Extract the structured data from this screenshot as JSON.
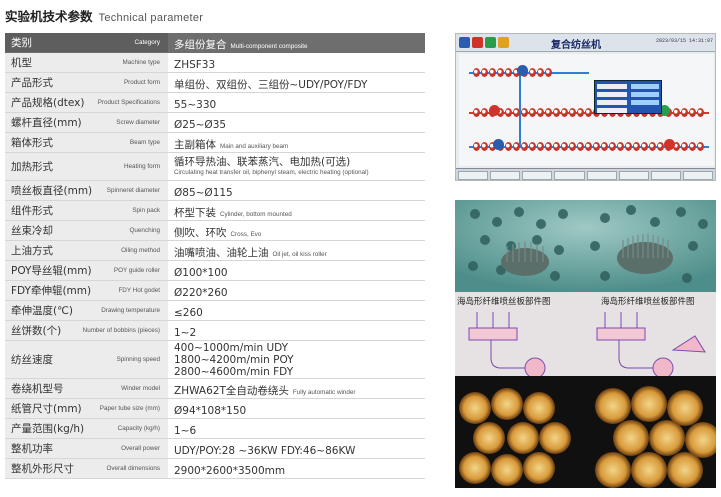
{
  "header": {
    "title_zh": "实验机技术参数",
    "title_en": "Technical parameter"
  },
  "table": {
    "rows": [
      {
        "zh": "类别",
        "en": "Category",
        "value": "多组份复合",
        "value_en": "Multi-component composite",
        "head": true
      },
      {
        "zh": "机型",
        "en": "Machine type",
        "value": "ZHSF33"
      },
      {
        "zh": "产品形式",
        "en": "Product form",
        "value": "单组份、双组份、三组份~UDY/POY/FDY"
      },
      {
        "zh": "产品规格(dtex)",
        "en": "Product Specifications",
        "value": "55~330"
      },
      {
        "zh": "螺杆直径(mm)",
        "en": "Screw diameter",
        "value": "Ø25~Ø35"
      },
      {
        "zh": "箱体形式",
        "en": "Beam type",
        "value": "主副箱体",
        "value_en": "Main and auxiliary beam"
      },
      {
        "zh": "加热形式",
        "en": "Heating form",
        "lines": [
          "循环导热油、联苯蒸汽、电加热(可选)"
        ],
        "sub": "Circulating heat transfer oil, biphenyl steam, electric heating (optional)"
      },
      {
        "zh": "喷丝板直径(mm)",
        "en": "Spinneret diameter",
        "value": "Ø85~Ø115"
      },
      {
        "zh": "组件形式",
        "en": "Spin pack",
        "value": "杯型下装",
        "value_en": "Cylinder, bottom mounted"
      },
      {
        "zh": "丝束冷却",
        "en": "Quenching",
        "value": "侧吹、环吹",
        "value_en": "Cross, Evo"
      },
      {
        "zh": "上油方式",
        "en": "Oiling method",
        "value": "油嘴喷油、油轮上油",
        "value_en": "Oil jet, oil kiss roller"
      },
      {
        "zh": "POY导丝辊(mm)",
        "en": "POY guide roller",
        "value": "Ø100*100"
      },
      {
        "zh": "FDY牵伸辊(mm)",
        "en": "FDY Hot godet",
        "value": "Ø220*260"
      },
      {
        "zh": "牵伸温度(℃)",
        "en": "Drawing temperature",
        "value": "≤260"
      },
      {
        "zh": "丝饼数(个)",
        "en": "Number of bobbins (pieces)",
        "value": "1~2"
      },
      {
        "zh": "纺丝速度",
        "en": "Spinning speed",
        "lines": [
          "400~1000m/min UDY",
          "1800~4200m/min POY",
          "2800~4600m/min FDY"
        ]
      },
      {
        "zh": "卷绕机型号",
        "en": "Winder model",
        "value": "ZHWA62T全自动卷绕头",
        "value_en": "Fully automatic winder"
      },
      {
        "zh": "纸管尺寸(mm)",
        "en": "Paper tube size (mm)",
        "value": "Ø94*108*150"
      },
      {
        "zh": "产量范围(kg/h)",
        "en": "Capacity (kg/h)",
        "value": "1~6"
      },
      {
        "zh": "整机功率",
        "en": "Overall power",
        "value": "UDY/POY:28 ~36KW      FDY:46~86KW"
      },
      {
        "zh": "整机外形尺寸",
        "en": "Overall dimensions",
        "value": "2900*2600*3500mm"
      }
    ]
  },
  "hmi": {
    "title": "复合纺丝机",
    "time": "2023/03/15 14:31:07"
  },
  "photo": {
    "caption_left": "海岛形纤维喷丝板部件图",
    "caption_right": "海岛形纤维喷丝板部件图"
  },
  "colors": {
    "header_bg": "#6e6e6e",
    "label_bg": "#ececec",
    "hmi_blue": "#2355b0",
    "roller_red": "#c9342a"
  }
}
